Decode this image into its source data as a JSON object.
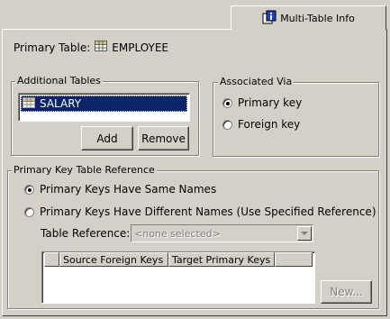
{
  "tab": {
    "label": "Multi-Table Info",
    "icon": "info-icon"
  },
  "primary_table": {
    "label": "Primary Table:",
    "name": "EMPLOYEE",
    "icon": "table-icon"
  },
  "additional_tables": {
    "title": "Additional Tables",
    "items": [
      {
        "label": "SALARY",
        "selected": true,
        "icon": "table-icon"
      }
    ],
    "add_label": "Add",
    "remove_label": "Remove"
  },
  "associated_via": {
    "title": "Associated Via",
    "options": [
      {
        "label": "Primary key",
        "checked": true
      },
      {
        "label": "Foreign key",
        "checked": false
      }
    ]
  },
  "pk_reference": {
    "title": "Primary Key Table Reference",
    "options": [
      {
        "label": "Primary Keys Have Same Names",
        "checked": true
      },
      {
        "label": "Primary Keys Have Different Names (Use Specified Reference)",
        "checked": false
      }
    ],
    "table_reference_label": "Table Reference:",
    "table_reference_value": "<none selected>",
    "columns": [
      "Source Foreign Keys",
      "Target Primary Keys"
    ],
    "new_label": "New..."
  },
  "colors": {
    "face": "#d4d0c8",
    "selection": "#0a246a",
    "shadow": "#808080"
  }
}
